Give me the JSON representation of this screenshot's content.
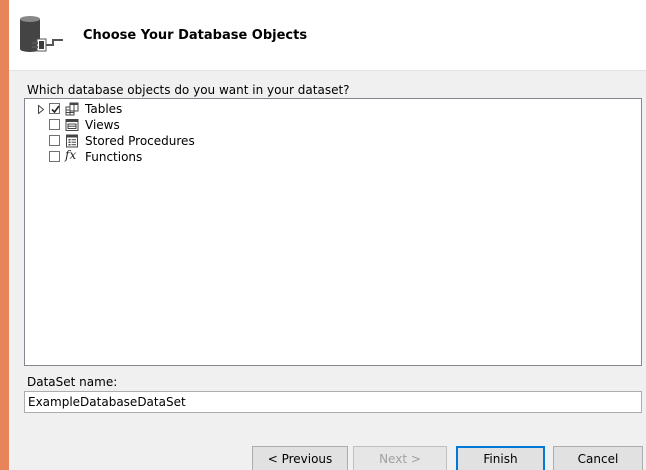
{
  "header": {
    "title": "Choose Your Database Objects",
    "icon": "database-plug-icon"
  },
  "prompt": "Which database objects do you want in your dataset?",
  "tree": {
    "items": [
      {
        "label": "Tables",
        "checked": true,
        "expandable": true,
        "icon": "tables-icon"
      },
      {
        "label": "Views",
        "checked": false,
        "expandable": false,
        "icon": "views-icon"
      },
      {
        "label": "Stored Procedures",
        "checked": false,
        "expandable": false,
        "icon": "stored-procedures-icon"
      },
      {
        "label": "Functions",
        "checked": false,
        "expandable": false,
        "icon": "functions-icon",
        "glyph": "fx"
      }
    ]
  },
  "dataset": {
    "label": "DataSet name:",
    "value": "ExampleDatabaseDataSet"
  },
  "buttons": {
    "previous": "< Previous",
    "next": "Next >",
    "finish": "Finish",
    "cancel": "Cancel"
  }
}
